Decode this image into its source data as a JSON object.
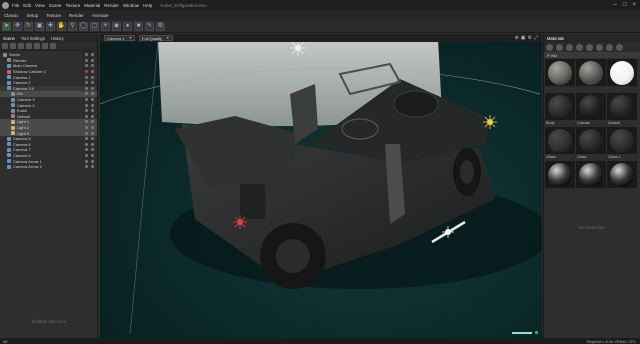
{
  "app": {
    "menu": [
      "File",
      "Edit",
      "View",
      "Scene",
      "Texture",
      "Material",
      "Render",
      "Window",
      "Help"
    ],
    "document_title": "Kubel_Exfiguration.keo"
  },
  "modes": [
    "Classic",
    "Setup",
    "Texture",
    "Render",
    "Animate"
  ],
  "scene_panel": {
    "tabs": [
      "Scene",
      "Tool Settings",
      "History"
    ],
    "tree": [
      {
        "label": "Scene",
        "type": "obj",
        "indent": 0,
        "state": ""
      },
      {
        "label": "Render",
        "type": "obj",
        "indent": 1,
        "state": ""
      },
      {
        "label": "Main Camera",
        "type": "cam",
        "indent": 1,
        "state": ""
      },
      {
        "label": "Shadow Catcher 2",
        "type": "shadow",
        "indent": 1,
        "state": ""
      },
      {
        "label": "Camera 1",
        "type": "cam",
        "indent": 1,
        "state": ""
      },
      {
        "label": "Camera 2",
        "type": "cam",
        "indent": 1,
        "state": ""
      },
      {
        "label": "Camera 3.9",
        "type": "cam",
        "indent": 1,
        "state": "hl"
      },
      {
        "label": "Kfz",
        "type": "obj",
        "indent": 2,
        "state": "selected"
      },
      {
        "label": "Camera 3",
        "type": "cam",
        "indent": 2,
        "state": ""
      },
      {
        "label": "Camera 4",
        "type": "cam",
        "indent": 2,
        "state": ""
      },
      {
        "label": "Kubel",
        "type": "obj",
        "indent": 2,
        "state": ""
      },
      {
        "label": "Default",
        "type": "obj",
        "indent": 2,
        "state": ""
      },
      {
        "label": "Light 1",
        "type": "light",
        "indent": 2,
        "state": "selected"
      },
      {
        "label": "Light 2",
        "type": "light",
        "indent": 2,
        "state": "selected"
      },
      {
        "label": "Light 3",
        "type": "light",
        "indent": 2,
        "state": "selected"
      },
      {
        "label": "Camera 5",
        "type": "cam",
        "indent": 1,
        "state": ""
      },
      {
        "label": "Camera 6",
        "type": "cam",
        "indent": 1,
        "state": ""
      },
      {
        "label": "Camera 7",
        "type": "cam",
        "indent": 1,
        "state": ""
      },
      {
        "label": "Camera 8",
        "type": "cam",
        "indent": 1,
        "state": ""
      },
      {
        "label": "Camera Arrow 1",
        "type": "cam",
        "indent": 1,
        "state": ""
      },
      {
        "label": "Camera Arrow 2",
        "type": "cam",
        "indent": 1,
        "state": ""
      }
    ],
    "footer": "Multiple selection"
  },
  "viewport": {
    "camera_select": "Camera 1",
    "quality_select": "Full Quality",
    "icons": [
      "⊕",
      "▣",
      "⚙",
      "⤢"
    ]
  },
  "materials_panel": {
    "tab": "Materials",
    "header": "P. Kfz",
    "items": [
      {
        "label": "",
        "color": "#6a6a64",
        "style": "metal"
      },
      {
        "label": "",
        "color": "#5a5a58",
        "style": "metal"
      },
      {
        "label": "",
        "color": "#f0f0f0",
        "style": "white"
      },
      {
        "label": "Body",
        "color": "#2a2a2a",
        "style": "dark"
      },
      {
        "label": "Canvas",
        "color": "#1e1e1e",
        "style": "dark"
      },
      {
        "label": "Default",
        "color": "#222222",
        "style": "dark"
      },
      {
        "label": "Glass",
        "color": "#303030",
        "style": "dark"
      },
      {
        "label": "Glass",
        "color": "#262626",
        "style": "dark"
      },
      {
        "label": "Glass 1",
        "color": "#2c2c2c",
        "style": "dark"
      },
      {
        "label": "",
        "color": "#3a3a3a",
        "style": "chrome"
      },
      {
        "label": "",
        "color": "#3a3a3a",
        "style": "chrome"
      },
      {
        "label": "",
        "color": "#3a3a3a",
        "style": "chrome"
      }
    ],
    "footer": "No Selection"
  },
  "status": {
    "left": "#8",
    "right": "Keyshot v 8.0b  VRAM / 2FL"
  },
  "colors": {
    "accent_green": "#3fbf5f",
    "viewport_bg": "#0c2a2b",
    "light_yellow": "#e8d050",
    "light_red": "#e04040"
  }
}
